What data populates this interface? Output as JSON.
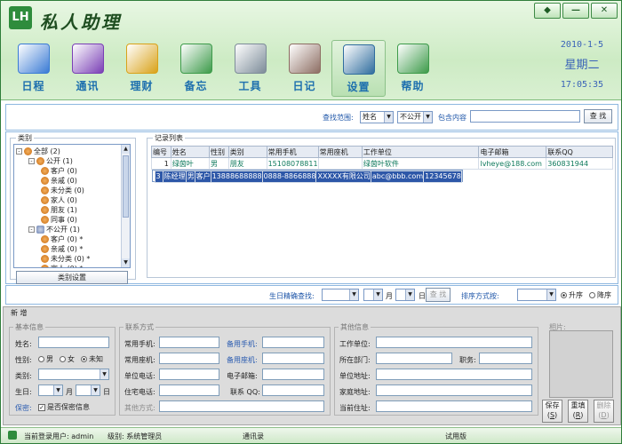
{
  "app": {
    "title": "私人助理",
    "logo_text": "LH"
  },
  "window_buttons": [
    "◆",
    "—",
    "✕"
  ],
  "toolbar": [
    {
      "label": "日程",
      "icon": "calendar-icon",
      "color": "#3a7bd5"
    },
    {
      "label": "通讯",
      "icon": "contacts-icon",
      "color": "#7a3fb5"
    },
    {
      "label": "理财",
      "icon": "finance-icon",
      "color": "#d9a219"
    },
    {
      "label": "备忘",
      "icon": "memo-icon",
      "color": "#3d9b4a"
    },
    {
      "label": "工具",
      "icon": "tools-icon",
      "color": "#7d8c99"
    },
    {
      "label": "日记",
      "icon": "diary-icon",
      "color": "#8d6e63"
    },
    {
      "label": "设置",
      "icon": "settings-icon",
      "color": "#2f6d9e",
      "active": true
    },
    {
      "label": "帮助",
      "icon": "help-icon",
      "color": "#3d9b4a"
    }
  ],
  "datetime": {
    "date": "2010-1-5",
    "weekday": "星期二",
    "time": "17:05:35"
  },
  "search": {
    "range_label": "查找范围:",
    "field_value": "姓名",
    "scope_value": "不公开",
    "contains_label": "包含内容",
    "button": "查 找"
  },
  "category": {
    "title": "类别",
    "tree": [
      {
        "label": "全部 (2)",
        "level": 0,
        "toggle": "-"
      },
      {
        "label": "公开 (1)",
        "level": 1,
        "toggle": "-"
      },
      {
        "label": "客户 (0)",
        "level": 2
      },
      {
        "label": "亲戚 (0)",
        "level": 2
      },
      {
        "label": "未分类 (0)",
        "level": 2
      },
      {
        "label": "家人 (0)",
        "level": 2
      },
      {
        "label": "朋友 (1)",
        "level": 2
      },
      {
        "label": "同事 (0)",
        "level": 2
      },
      {
        "label": "不公开 (1)",
        "level": 1,
        "toggle": "-",
        "grey": true
      },
      {
        "label": "客户 (0) *",
        "level": 2,
        "grey": true
      },
      {
        "label": "亲戚 (0) *",
        "level": 2,
        "grey": true
      },
      {
        "label": "未分类 (0) *",
        "level": 2,
        "grey": true
      },
      {
        "label": "家人 (0) *",
        "level": 2,
        "grey": true
      }
    ],
    "button": "类别设置"
  },
  "records": {
    "title": "记录列表",
    "columns": [
      "编号",
      "姓名",
      "性别",
      "类别",
      "常用手机",
      "常用座机",
      "工作单位",
      "电子邮箱",
      "联系QQ"
    ],
    "rows": [
      [
        "1",
        "绿茵叶",
        "男",
        "朋友",
        "15108078811",
        "",
        "绿茵叶软件",
        "lvheye@188.com",
        "360831944"
      ],
      [
        "3",
        "陈经理",
        "男",
        "客户",
        "13888688888",
        "0888-8866888",
        "XXXXX有限公司",
        "abc@bbb.com",
        "12345678"
      ]
    ],
    "selected_row": 1
  },
  "filter": {
    "birthday_label": "生日精确查找:",
    "month_label": "月",
    "day_label": "日",
    "find_button": "查 找",
    "sort_label": "排序方式按:",
    "asc_label": "升序",
    "desc_label": "降序"
  },
  "new_entry": {
    "title": "新 增",
    "basic": {
      "title": "基本信息",
      "name_label": "姓名:",
      "gender_label": "性别:",
      "male": "男",
      "female": "女",
      "unknown": "未知",
      "category_label": "类别:",
      "birthday_label": "生日:",
      "month": "月",
      "day": "日",
      "privacy_label": "保密:",
      "privacy_option": "是否保密信息"
    },
    "contact": {
      "title": "联系方式",
      "mobile": "常用手机:",
      "phone": "常用座机:",
      "work_phone": "单位电话:",
      "home_phone": "住宅电话:",
      "other": "其他方式:",
      "alt_mobile": "备用手机:",
      "alt_phone": "备用座机:",
      "email": "电子邮箱:",
      "qq": "联系 QQ:"
    },
    "other": {
      "title": "其他信息",
      "work_unit": "工作单位:",
      "department": "所在部门:",
      "position": "职务:",
      "work_address": "单位地址:",
      "home_address": "家庭地址:",
      "current_address": "当前住址:"
    },
    "photo_label": "相片:",
    "save": "保存",
    "save_key": "S",
    "reset": "重填",
    "reset_key": "R",
    "delete": "删除",
    "delete_key": "D"
  },
  "status": {
    "user": "当前登录用户: admin",
    "level": "级别: 系统管理员",
    "section": "通讯录",
    "edition": "试用版"
  }
}
